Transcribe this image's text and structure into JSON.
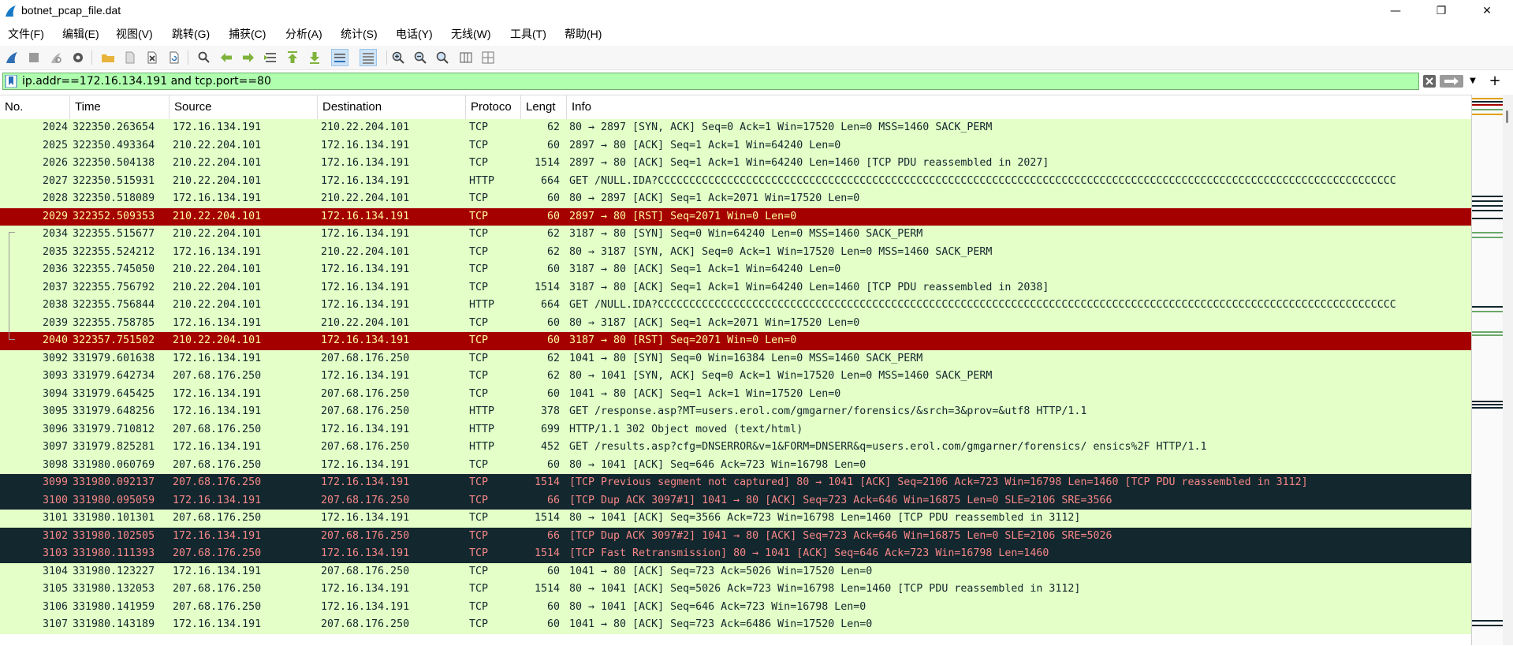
{
  "window": {
    "title": "botnet_pcap_file.dat",
    "minimize": "—",
    "restore": "❐",
    "close": "✕"
  },
  "menu": [
    "文件(F)",
    "编辑(E)",
    "视图(V)",
    "跳转(G)",
    "捕获(C)",
    "分析(A)",
    "统计(S)",
    "电话(Y)",
    "无线(W)",
    "工具(T)",
    "帮助(H)"
  ],
  "filter": {
    "value": "ip.addr==172.16.134.191 and tcp.port==80",
    "bg_color": "#afffaf",
    "plus": "+"
  },
  "columns": [
    "No.",
    "Time",
    "Source",
    "Destination",
    "Protoco",
    "Lengt",
    "Info"
  ],
  "colors": {
    "green_bg": "#e4ffc7",
    "red_bg": "#a40000",
    "red_fg": "#fffc9c",
    "dark_bg": "#12272e",
    "dark_fg": "#f78787",
    "normal_fg": "#12272e"
  },
  "rows": [
    {
      "no": "2024",
      "time": "322350.263654",
      "src": "172.16.134.191",
      "dst": "210.22.204.101",
      "proto": "TCP",
      "len": "62",
      "info": "80 → 2897 [SYN, ACK] Seq=0 Ack=1 Win=17520 Len=0 MSS=1460 SACK_PERM",
      "style": "green"
    },
    {
      "no": "2025",
      "time": "322350.493364",
      "src": "210.22.204.101",
      "dst": "172.16.134.191",
      "proto": "TCP",
      "len": "60",
      "info": "2897 → 80 [ACK] Seq=1 Ack=1 Win=64240 Len=0",
      "style": "green"
    },
    {
      "no": "2026",
      "time": "322350.504138",
      "src": "210.22.204.101",
      "dst": "172.16.134.191",
      "proto": "TCP",
      "len": "1514",
      "info": "2897 → 80 [ACK] Seq=1 Ack=1 Win=64240 Len=1460 [TCP PDU reassembled in 2027]",
      "style": "green"
    },
    {
      "no": "2027",
      "time": "322350.515931",
      "src": "210.22.204.101",
      "dst": "172.16.134.191",
      "proto": "HTTP",
      "len": "664",
      "info": "GET /NULL.IDA?CCCCCCCCCCCCCCCCCCCCCCCCCCCCCCCCCCCCCCCCCCCCCCCCCCCCCCCCCCCCCCCCCCCCCCCCCCCCCCCCCCCCCCCCCCCCCCCCCCCCCCCCCCCCCCCCCCCCC",
      "style": "green"
    },
    {
      "no": "2028",
      "time": "322350.518089",
      "src": "172.16.134.191",
      "dst": "210.22.204.101",
      "proto": "TCP",
      "len": "60",
      "info": "80 → 2897 [ACK] Seq=1 Ack=2071 Win=17520 Len=0",
      "style": "green"
    },
    {
      "no": "2029",
      "time": "322352.509353",
      "src": "210.22.204.101",
      "dst": "172.16.134.191",
      "proto": "TCP",
      "len": "60",
      "info": "2897 → 80 [RST] Seq=2071 Win=0 Len=0",
      "style": "red"
    },
    {
      "no": "2034",
      "time": "322355.515677",
      "src": "210.22.204.101",
      "dst": "172.16.134.191",
      "proto": "TCP",
      "len": "62",
      "info": "3187 → 80 [SYN] Seq=0 Win=64240 Len=0 MSS=1460 SACK_PERM",
      "style": "green"
    },
    {
      "no": "2035",
      "time": "322355.524212",
      "src": "172.16.134.191",
      "dst": "210.22.204.101",
      "proto": "TCP",
      "len": "62",
      "info": "80 → 3187 [SYN, ACK] Seq=0 Ack=1 Win=17520 Len=0 MSS=1460 SACK_PERM",
      "style": "green"
    },
    {
      "no": "2036",
      "time": "322355.745050",
      "src": "210.22.204.101",
      "dst": "172.16.134.191",
      "proto": "TCP",
      "len": "60",
      "info": "3187 → 80 [ACK] Seq=1 Ack=1 Win=64240 Len=0",
      "style": "green"
    },
    {
      "no": "2037",
      "time": "322355.756792",
      "src": "210.22.204.101",
      "dst": "172.16.134.191",
      "proto": "TCP",
      "len": "1514",
      "info": "3187 → 80 [ACK] Seq=1 Ack=1 Win=64240 Len=1460 [TCP PDU reassembled in 2038]",
      "style": "green"
    },
    {
      "no": "2038",
      "time": "322355.756844",
      "src": "210.22.204.101",
      "dst": "172.16.134.191",
      "proto": "HTTP",
      "len": "664",
      "info": "GET /NULL.IDA?CCCCCCCCCCCCCCCCCCCCCCCCCCCCCCCCCCCCCCCCCCCCCCCCCCCCCCCCCCCCCCCCCCCCCCCCCCCCCCCCCCCCCCCCCCCCCCCCCCCCCCCCCCCCCCCCCCCCC",
      "style": "green"
    },
    {
      "no": "2039",
      "time": "322355.758785",
      "src": "172.16.134.191",
      "dst": "210.22.204.101",
      "proto": "TCP",
      "len": "60",
      "info": "80 → 3187 [ACK] Seq=1 Ack=2071 Win=17520 Len=0",
      "style": "green"
    },
    {
      "no": "2040",
      "time": "322357.751502",
      "src": "210.22.204.101",
      "dst": "172.16.134.191",
      "proto": "TCP",
      "len": "60",
      "info": "3187 → 80 [RST] Seq=2071 Win=0 Len=0",
      "style": "red"
    },
    {
      "no": "3092",
      "time": "331979.601638",
      "src": "172.16.134.191",
      "dst": "207.68.176.250",
      "proto": "TCP",
      "len": "62",
      "info": "1041 → 80 [SYN] Seq=0 Win=16384 Len=0 MSS=1460 SACK_PERM",
      "style": "green"
    },
    {
      "no": "3093",
      "time": "331979.642734",
      "src": "207.68.176.250",
      "dst": "172.16.134.191",
      "proto": "TCP",
      "len": "62",
      "info": "80 → 1041 [SYN, ACK] Seq=0 Ack=1 Win=17520 Len=0 MSS=1460 SACK_PERM",
      "style": "green"
    },
    {
      "no": "3094",
      "time": "331979.645425",
      "src": "172.16.134.191",
      "dst": "207.68.176.250",
      "proto": "TCP",
      "len": "60",
      "info": "1041 → 80 [ACK] Seq=1 Ack=1 Win=17520 Len=0",
      "style": "green"
    },
    {
      "no": "3095",
      "time": "331979.648256",
      "src": "172.16.134.191",
      "dst": "207.68.176.250",
      "proto": "HTTP",
      "len": "378",
      "info": "GET /response.asp?MT=users.erol.com/gmgarner/forensics/&srch=3&prov=&utf8 HTTP/1.1",
      "style": "green"
    },
    {
      "no": "3096",
      "time": "331979.710812",
      "src": "207.68.176.250",
      "dst": "172.16.134.191",
      "proto": "HTTP",
      "len": "699",
      "info": "HTTP/1.1 302 Object moved  (text/html)",
      "style": "green"
    },
    {
      "no": "3097",
      "time": "331979.825281",
      "src": "172.16.134.191",
      "dst": "207.68.176.250",
      "proto": "HTTP",
      "len": "452",
      "info": "GET /results.asp?cfg=DNSERROR&v=1&FORM=DNSERR&q=users.erol.com/gmgarner/forensics/ ensics%2F HTTP/1.1",
      "style": "green"
    },
    {
      "no": "3098",
      "time": "331980.060769",
      "src": "207.68.176.250",
      "dst": "172.16.134.191",
      "proto": "TCP",
      "len": "60",
      "info": "80 → 1041 [ACK] Seq=646 Ack=723 Win=16798 Len=0",
      "style": "green"
    },
    {
      "no": "3099",
      "time": "331980.092137",
      "src": "207.68.176.250",
      "dst": "172.16.134.191",
      "proto": "TCP",
      "len": "1514",
      "info": "[TCP Previous segment not captured] 80 → 1041 [ACK] Seq=2106 Ack=723 Win=16798 Len=1460 [TCP PDU reassembled in 3112]",
      "style": "dark"
    },
    {
      "no": "3100",
      "time": "331980.095059",
      "src": "172.16.134.191",
      "dst": "207.68.176.250",
      "proto": "TCP",
      "len": "66",
      "info": "[TCP Dup ACK 3097#1] 1041 → 80 [ACK] Seq=723 Ack=646 Win=16875 Len=0 SLE=2106 SRE=3566",
      "style": "dark"
    },
    {
      "no": "3101",
      "time": "331980.101301",
      "src": "207.68.176.250",
      "dst": "172.16.134.191",
      "proto": "TCP",
      "len": "1514",
      "info": "80 → 1041 [ACK] Seq=3566 Ack=723 Win=16798 Len=1460 [TCP PDU reassembled in 3112]",
      "style": "green"
    },
    {
      "no": "3102",
      "time": "331980.102505",
      "src": "172.16.134.191",
      "dst": "207.68.176.250",
      "proto": "TCP",
      "len": "66",
      "info": "[TCP Dup ACK 3097#2] 1041 → 80 [ACK] Seq=723 Ack=646 Win=16875 Len=0 SLE=2106 SRE=5026",
      "style": "dark"
    },
    {
      "no": "3103",
      "time": "331980.111393",
      "src": "207.68.176.250",
      "dst": "172.16.134.191",
      "proto": "TCP",
      "len": "1514",
      "info": "[TCP Fast Retransmission] 80 → 1041 [ACK] Seq=646 Ack=723 Win=16798 Len=1460",
      "style": "dark"
    },
    {
      "no": "3104",
      "time": "331980.123227",
      "src": "172.16.134.191",
      "dst": "207.68.176.250",
      "proto": "TCP",
      "len": "60",
      "info": "1041 → 80 [ACK] Seq=723 Ack=5026 Win=17520 Len=0",
      "style": "green"
    },
    {
      "no": "3105",
      "time": "331980.132053",
      "src": "207.68.176.250",
      "dst": "172.16.134.191",
      "proto": "TCP",
      "len": "1514",
      "info": "80 → 1041 [ACK] Seq=5026 Ack=723 Win=16798 Len=1460 [TCP PDU reassembled in 3112]",
      "style": "green"
    },
    {
      "no": "3106",
      "time": "331980.141959",
      "src": "207.68.176.250",
      "dst": "172.16.134.191",
      "proto": "TCP",
      "len": "60",
      "info": "80 → 1041 [ACK] Seq=646 Ack=723 Win=16798 Len=0",
      "style": "green"
    },
    {
      "no": "3107",
      "time": "331980.143189",
      "src": "172.16.134.191",
      "dst": "207.68.176.250",
      "proto": "TCP",
      "len": "60",
      "info": "1041 → 80 [ACK] Seq=723 Ack=6486 Win=17520 Len=0",
      "style": "green"
    }
  ]
}
